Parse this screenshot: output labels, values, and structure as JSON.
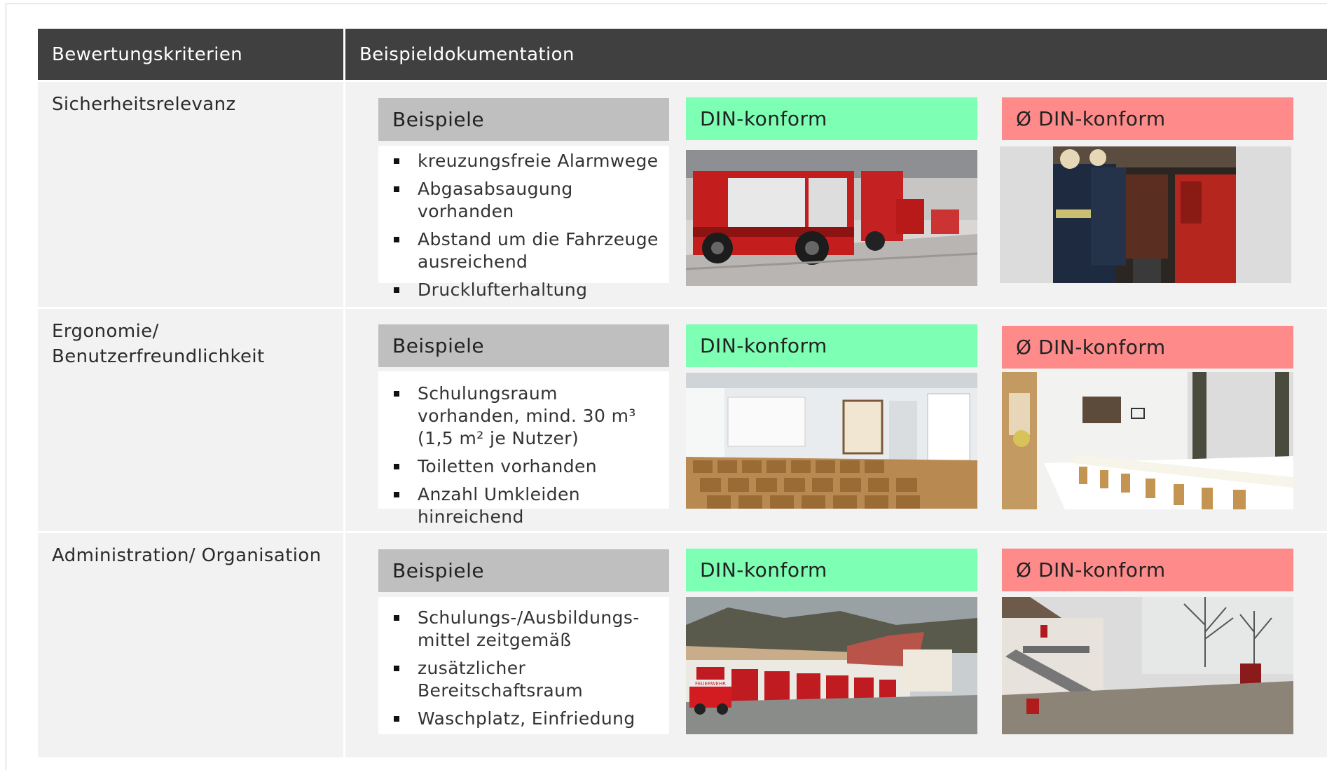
{
  "header": {
    "col1": "Bewertungskriterien",
    "col2": "Beispieldokumentation"
  },
  "rows": [
    {
      "criterion": "Sicherheitsrelevanz",
      "examples_label": "Beispiele",
      "ok_label": "DIN-konform",
      "not_ok_label": "Ø DIN-konform",
      "bullets": [
        "kreuzungsfreie Alarmwege",
        "Abgasabsaugung vorhanden",
        "Abstand um die Fahrzeuge ausreichend",
        "Drucklufterhaltung"
      ]
    },
    {
      "criterion": "Ergonomie/ Benutzerfreundlichkeit",
      "examples_label": "Beispiele",
      "ok_label": "DIN-konform",
      "not_ok_label": "Ø DIN-konform",
      "bullets": [
        "Schulungsraum vorhanden, mind. 30 m³ (1,5 m² je Nutzer)",
        "Toiletten vorhanden",
        "Anzahl Umkleiden hinreichend"
      ]
    },
    {
      "criterion": "Administration/ Organisation",
      "examples_label": "Beispiele",
      "ok_label": "DIN-konform",
      "not_ok_label": "Ø DIN-konform",
      "bullets": [
        "Schulungs-/Ausbildungs-mittel zeitgemäß",
        "zusätzlicher Bereitschaftsraum",
        "Waschplatz, Einfriedung"
      ]
    }
  ],
  "photo_labels": {
    "truck_sign": "FEUERWEHR"
  },
  "colors": {
    "header_bg": "#404040",
    "examples_bg": "#bfbfbf",
    "din_ok_bg": "#7dffb4",
    "din_not_ok_bg": "#ff8a8a",
    "cell_bg": "#f2f2f2"
  }
}
